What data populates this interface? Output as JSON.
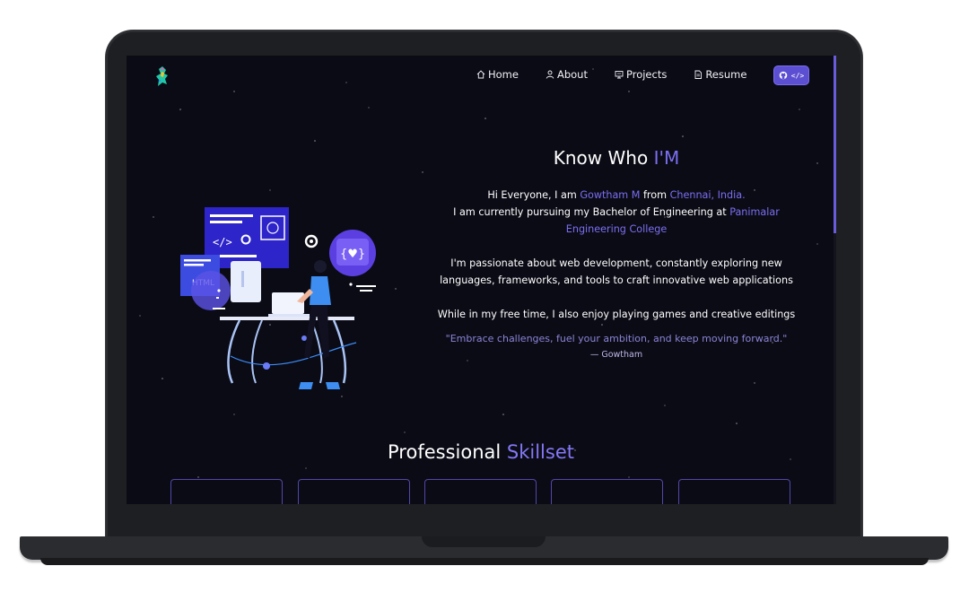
{
  "nav": {
    "items": [
      {
        "label": "Home",
        "icon": "home-icon"
      },
      {
        "label": "About",
        "icon": "user-icon"
      },
      {
        "label": "Projects",
        "icon": "projects-icon"
      },
      {
        "label": "Resume",
        "icon": "document-icon"
      }
    ],
    "github_icon": "github-icon",
    "code_icon": "code-icon"
  },
  "hero": {
    "title_prefix": "Know Who ",
    "title_accent": "I'M",
    "intro": {
      "greeting": "Hi Everyone, I am ",
      "name": "Gowtham M",
      "from": " from ",
      "location": "Chennai, India.",
      "study": "I am currently pursuing my Bachelor of Engineering at ",
      "college": "Panimalar Engineering College"
    },
    "passion": "I'm passionate about web development, constantly exploring new languages, frameworks, and tools to craft innovative web applications",
    "free_time": "While in my free time, I also enjoy playing games and creative editings",
    "quote": "\"Embrace challenges, fuel your ambition, and keep moving forward.\"",
    "quote_author": "— Gowtham"
  },
  "skills": {
    "title_prefix": "Professional ",
    "title_accent": "Skillset",
    "card_count": 5
  },
  "colors": {
    "accent": "#7b6ff0",
    "background": "#0b0b16",
    "button": "#5d4fd1"
  }
}
